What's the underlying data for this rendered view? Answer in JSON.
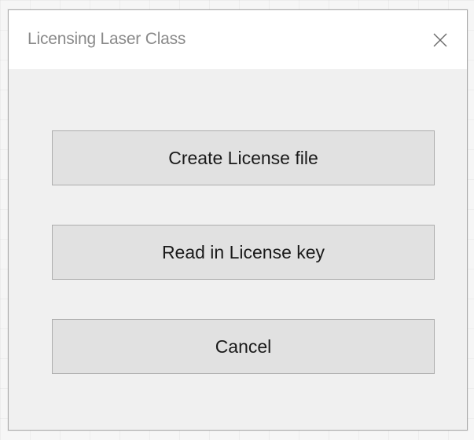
{
  "dialog": {
    "title": "Licensing Laser Class",
    "close_icon": "close-icon",
    "buttons": {
      "create_license_file": "Create License file",
      "read_in_license_key": "Read in License key",
      "cancel": "Cancel"
    }
  },
  "colors": {
    "dialog_background": "#f0f0f0",
    "titlebar_background": "#ffffff",
    "button_face": "#e1e1e1",
    "button_border": "#adadad",
    "title_text": "#8a8a8a"
  }
}
